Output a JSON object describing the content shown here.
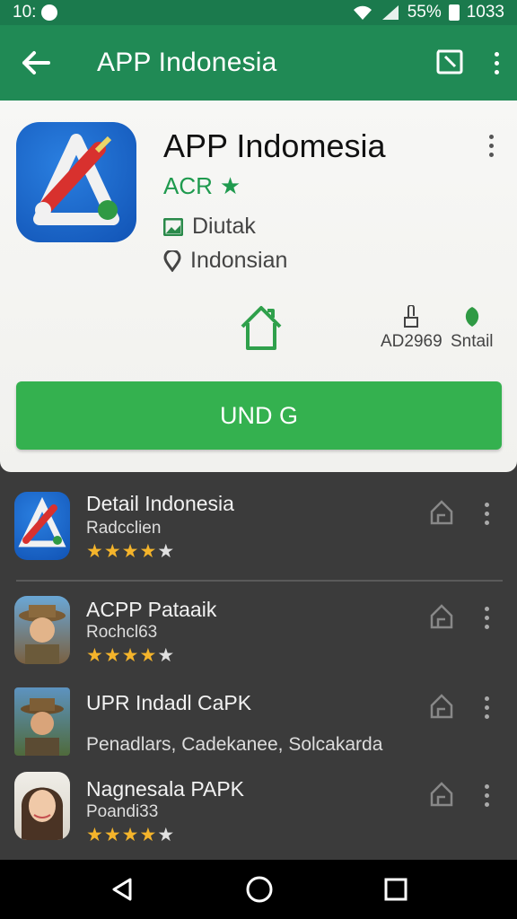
{
  "status": {
    "time": "10:",
    "battery": "55%",
    "clock": "1033"
  },
  "app_bar": {
    "title": "APP Indonesia"
  },
  "detail": {
    "title": "APP Indomesia",
    "developer": "ACR",
    "category": "Diutak",
    "location": "Indonsian",
    "stat1": "AD2969",
    "stat2": "Sntail",
    "install_label": "UND G"
  },
  "list": [
    {
      "name": "Detail Indonesia",
      "sub": "Radcclien",
      "rating": 4
    },
    {
      "name": "ACPP Pataaik",
      "sub": "Rochcl63",
      "rating": 4
    },
    {
      "name": "UPR Indadl CaPK",
      "sub": "Penadlars, Cadekanee, Solcakarda",
      "rating": null
    },
    {
      "name": "Nagnesala PAPK",
      "sub": "Poandi33",
      "rating": 4
    }
  ],
  "colors": {
    "primary": "#208a55",
    "accent": "#34b14f",
    "star": "#f4b42b"
  }
}
